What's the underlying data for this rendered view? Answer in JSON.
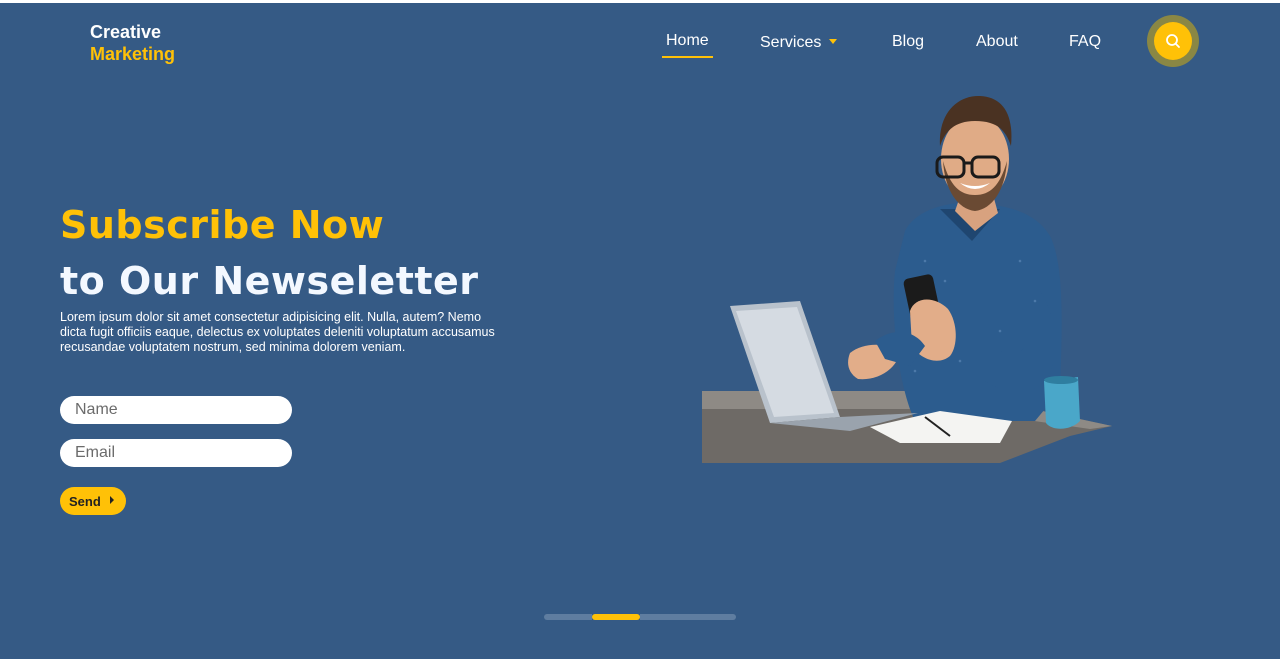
{
  "brand": {
    "line1": "Creative",
    "line2": "Marketing"
  },
  "nav": {
    "items": [
      {
        "label": "Home",
        "active": true
      },
      {
        "label": "Services",
        "has_dropdown": true
      },
      {
        "label": "Blog"
      },
      {
        "label": "About"
      },
      {
        "label": "FAQ"
      }
    ],
    "search_icon": "search-icon"
  },
  "hero": {
    "headline_1": "Subscribe Now",
    "headline_2": "to Our Newseletter",
    "description": "Lorem ipsum dolor sit amet consectetur adipisicing elit. Nulla, autem? Nemo dicta fugit officiis eaque, delectus ex voluptates deleniti voluptatum accusamus recusandae voluptatem nostrum, sed minima dolorem veniam.",
    "form": {
      "name_placeholder": "Name",
      "email_placeholder": "Email",
      "send_label": "Send"
    },
    "image": "man-with-laptop-and-phone-photo"
  },
  "slider": {
    "count": 4,
    "active_index": 1
  },
  "colors": {
    "background": "#355a85",
    "accent": "#ffc107",
    "text": "#ffffff"
  }
}
